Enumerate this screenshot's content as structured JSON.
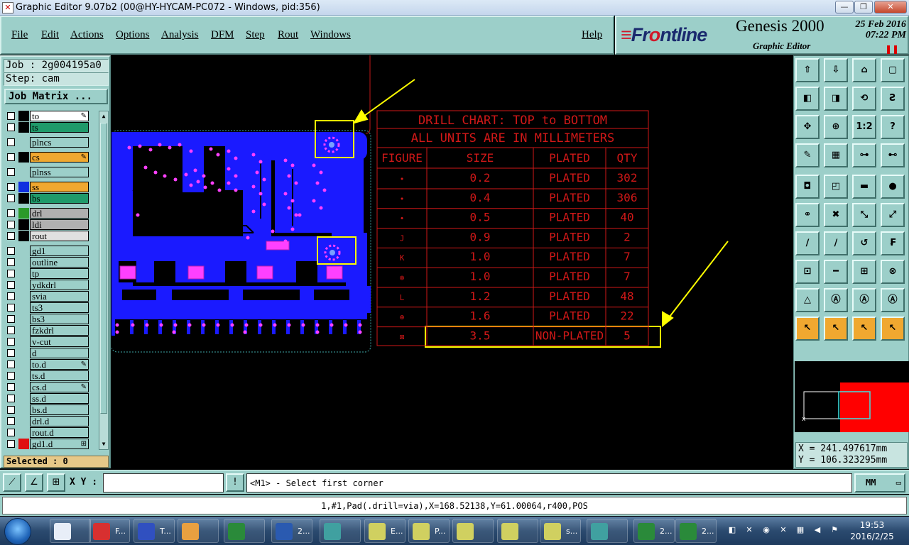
{
  "window": {
    "title": "Graphic Editor 9.07b2 (00@HY-HYCAM-PC072 - Windows, pid:356)"
  },
  "menu": {
    "file": "File",
    "edit": "Edit",
    "actions": "Actions",
    "options": "Options",
    "analysis": "Analysis",
    "dfm": "DFM",
    "step": "Step",
    "rout": "Rout",
    "windows": "Windows",
    "help": "Help"
  },
  "brand": {
    "logo_a": "Fr",
    "logo_b": "o",
    "logo_c": "ntline",
    "product": "Genesis 2000",
    "subtitle": "Graphic Editor",
    "date": "25 Feb 2016",
    "time": "07:22 PM"
  },
  "job": {
    "job_line": "Job : 2g004195a0",
    "step_line": "Step: cam",
    "matrix_button": "Job Matrix ...",
    "selected": "Selected : 0"
  },
  "layers": [
    {
      "name": "to",
      "color": "#000000",
      "bg": "#ffffff",
      "mark": "✎"
    },
    {
      "name": "ts",
      "color": "#000000",
      "bg": "#1f9a6a",
      "mark": ""
    },
    {
      "name": "plncs",
      "color": "#9ccfc9",
      "bg": "#9ccfc9",
      "mark": ""
    },
    {
      "name": "cs",
      "color": "#000000",
      "bg": "#f0a830",
      "mark": "✎"
    },
    {
      "name": "plnss",
      "color": "#9ccfc9",
      "bg": "#9ccfc9",
      "mark": ""
    },
    {
      "name": "ss",
      "color": "#1030e0",
      "bg": "#f0a830",
      "mark": ""
    },
    {
      "name": "bs",
      "color": "#000000",
      "bg": "#1f9a6a",
      "mark": ""
    },
    {
      "name": "drl",
      "color": "#2a9a2a",
      "bg": "#b0b0b0",
      "mark": ""
    },
    {
      "name": "ldi",
      "color": "#000000",
      "bg": "#b0b0b0",
      "mark": ""
    },
    {
      "name": "rout",
      "color": "#000000",
      "bg": "#e0e0e0",
      "mark": ""
    },
    {
      "name": "gd1",
      "color": "#9ccfc9",
      "bg": "#9ccfc9",
      "mark": ""
    },
    {
      "name": "outline",
      "color": "#9ccfc9",
      "bg": "#9ccfc9",
      "mark": ""
    },
    {
      "name": "tp",
      "color": "#9ccfc9",
      "bg": "#9ccfc9",
      "mark": ""
    },
    {
      "name": "ydkdrl",
      "color": "#9ccfc9",
      "bg": "#9ccfc9",
      "mark": ""
    },
    {
      "name": "svia",
      "color": "#9ccfc9",
      "bg": "#9ccfc9",
      "mark": ""
    },
    {
      "name": "ts3",
      "color": "#9ccfc9",
      "bg": "#9ccfc9",
      "mark": ""
    },
    {
      "name": "bs3",
      "color": "#9ccfc9",
      "bg": "#9ccfc9",
      "mark": ""
    },
    {
      "name": "fzkdrl",
      "color": "#9ccfc9",
      "bg": "#9ccfc9",
      "mark": ""
    },
    {
      "name": "v-cut",
      "color": "#9ccfc9",
      "bg": "#9ccfc9",
      "mark": ""
    },
    {
      "name": "d",
      "color": "#9ccfc9",
      "bg": "#9ccfc9",
      "mark": ""
    },
    {
      "name": "to.d",
      "color": "#9ccfc9",
      "bg": "#9ccfc9",
      "mark": "✎"
    },
    {
      "name": "ts.d",
      "color": "#9ccfc9",
      "bg": "#9ccfc9",
      "mark": ""
    },
    {
      "name": "cs.d",
      "color": "#9ccfc9",
      "bg": "#9ccfc9",
      "mark": "✎"
    },
    {
      "name": "ss.d",
      "color": "#9ccfc9",
      "bg": "#9ccfc9",
      "mark": ""
    },
    {
      "name": "bs.d",
      "color": "#9ccfc9",
      "bg": "#9ccfc9",
      "mark": ""
    },
    {
      "name": "drl.d",
      "color": "#9ccfc9",
      "bg": "#9ccfc9",
      "mark": ""
    },
    {
      "name": "rout.d",
      "color": "#9ccfc9",
      "bg": "#9ccfc9",
      "mark": ""
    },
    {
      "name": "gd1.d",
      "color": "#e01010",
      "bg": "#9ccfc9",
      "mark": "⊞"
    }
  ],
  "drill_chart": {
    "title1": "DRILL CHART: TOP to BOTTOM",
    "title2": "ALL UNITS ARE IN MILLIMETERS",
    "headers": [
      "FIGURE",
      "SIZE",
      "PLATED",
      "QTY"
    ],
    "rows": [
      {
        "fig": "•",
        "size": "0.2",
        "plated": "PLATED",
        "qty": "302"
      },
      {
        "fig": "•",
        "size": "0.4",
        "plated": "PLATED",
        "qty": "306"
      },
      {
        "fig": "•",
        "size": "0.5",
        "plated": "PLATED",
        "qty": "40"
      },
      {
        "fig": "J",
        "size": "0.9",
        "plated": "PLATED",
        "qty": "2"
      },
      {
        "fig": "K",
        "size": "1.0",
        "plated": "PLATED",
        "qty": "7"
      },
      {
        "fig": "⊗",
        "size": "1.0",
        "plated": "PLATED",
        "qty": "7"
      },
      {
        "fig": "L",
        "size": "1.2",
        "plated": "PLATED",
        "qty": "48"
      },
      {
        "fig": "⊕",
        "size": "1.6",
        "plated": "PLATED",
        "qty": "22"
      },
      {
        "fig": "⊠",
        "size": "3.5",
        "plated": "NON-PLATED",
        "qty": "5"
      }
    ]
  },
  "coords": {
    "x": "X = 241.497617mm",
    "y": "Y = 106.323295mm"
  },
  "command": {
    "xy_label": "X Y :",
    "xy_value": "",
    "prompt": "<M1> - Select first corner",
    "units": "MM"
  },
  "status": {
    "text": "1,#1,Pad(.drill=via),X=168.52138,Y=61.00064,r400,POS"
  },
  "taskbar": {
    "items": [
      {
        "label": "",
        "icon": "notepad-icon",
        "color": "#e8eef8"
      },
      {
        "label": "F...",
        "icon": "foxmail-icon",
        "color": "#d83030"
      },
      {
        "label": "T...",
        "icon": "floppy-icon",
        "color": "#3050c0"
      },
      {
        "label": "",
        "icon": "shell-icon",
        "color": "#e8a040"
      },
      {
        "label": "",
        "icon": "app-p-icon",
        "color": "#2a8a3a"
      },
      {
        "label": "2...",
        "icon": "word-icon",
        "color": "#2a5ab0"
      },
      {
        "label": "",
        "icon": "genesis-icon",
        "color": "#40a0a0"
      },
      {
        "label": "E...",
        "icon": "xwindow-icon",
        "color": "#d0d060"
      },
      {
        "label": "P...",
        "icon": "xwindow-icon",
        "color": "#d0d060"
      },
      {
        "label": "",
        "icon": "xwindow-icon",
        "color": "#d0d060"
      },
      {
        "label": "",
        "icon": "xwindow-icon",
        "color": "#d0d060"
      },
      {
        "label": "s...",
        "icon": "xwindow-icon",
        "color": "#d0d060"
      },
      {
        "label": "",
        "icon": "genesis-icon",
        "color": "#40a0a0"
      },
      {
        "label": "2...",
        "icon": "excel-icon",
        "color": "#2a8a3a"
      },
      {
        "label": "2...",
        "icon": "excel-icon",
        "color": "#2a8a3a"
      }
    ],
    "clock_time": "19:53",
    "clock_date": "2016/2/25"
  },
  "colors": {
    "panel": "#9ccfc9",
    "copper": "#1a1aff",
    "pad": "#ff40ff",
    "chart_red": "#d01818",
    "highlight": "#ffff00"
  }
}
